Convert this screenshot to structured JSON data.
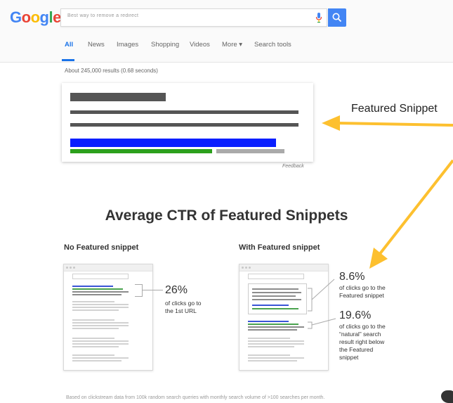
{
  "header": {
    "logo_letters": [
      {
        "char": "G",
        "color": "#4285f4"
      },
      {
        "char": "o",
        "color": "#ea4335"
      },
      {
        "char": "o",
        "color": "#fbbc05"
      },
      {
        "char": "g",
        "color": "#4285f4"
      },
      {
        "char": "l",
        "color": "#34a853"
      },
      {
        "char": "e",
        "color": "#ea4335"
      }
    ],
    "search_value": "Best way to remove a redirect",
    "mic_icon": "microphone-icon",
    "search_icon": "magnifier-icon"
  },
  "tabs": [
    {
      "label": "All",
      "active": true
    },
    {
      "label": "News",
      "active": false
    },
    {
      "label": "Images",
      "active": false
    },
    {
      "label": "Shopping",
      "active": false
    },
    {
      "label": "Videos",
      "active": false
    },
    {
      "label": "More ▾",
      "active": false
    },
    {
      "label": "Search tools",
      "active": false
    }
  ],
  "result_count": "About 245,000 results (0.68 seconds)",
  "snippet": {
    "feedback": "Feedback",
    "label": "Featured Snippet",
    "colors": {
      "title": "#555555",
      "text": "#555555",
      "link": "#0a1fff",
      "url": "#2ca01c",
      "meta": "#aaaaaa",
      "arrow": "#fdc02f"
    }
  },
  "infographic": {
    "title": "Average CTR of Featured Snippets",
    "left": {
      "heading": "No Featured snippet",
      "pct": "26%",
      "desc_lines": [
        "of clicks go to",
        "the 1st URL"
      ]
    },
    "right": {
      "heading": "With Featured snippet",
      "pct1": "8.6%",
      "desc1_lines": [
        "of clicks go to the",
        "Featured snippet"
      ],
      "pct2": "19.6%",
      "desc2_lines": [
        "of clicks go to the",
        "“natural” search",
        "result right below",
        "the Featured",
        "snippet"
      ]
    },
    "footnote": "Based on clickstream data from 100k random search queries with monthly search volume of >100 searches per month."
  }
}
